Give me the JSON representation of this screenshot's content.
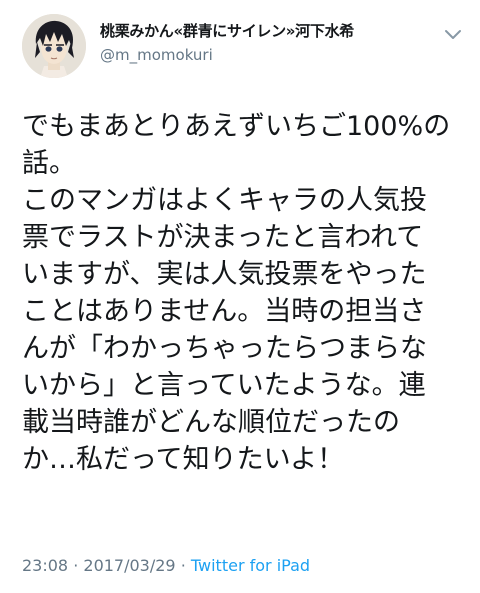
{
  "tweet": {
    "display_name": "桃栗みかん«群青にサイレン»河下水希",
    "handle": "@m_momokuri",
    "lines": [
      "でもまあとりあえずいちご100%の",
      "話。",
      "このマンガはよくキャラの人気投",
      "票でラストが決まったと言われて",
      "いますが、実は人気投票をやった",
      "ことはありません。当時の担当さ",
      "んが「わかっちゃったらつまらな",
      "いから」と言っていたような。連",
      "載当時誰がどんな順位だったの",
      "か…私だって知りたいよ！"
    ],
    "time": "23:08",
    "date": "2017/03/29",
    "separator": "·",
    "source": "Twitter for iPad"
  },
  "icons": {
    "avatar": "user-avatar-illustration",
    "caret": "chevron-down-icon"
  },
  "colors": {
    "text": "#14171a",
    "secondary": "#657786",
    "link": "#1da1f2"
  }
}
